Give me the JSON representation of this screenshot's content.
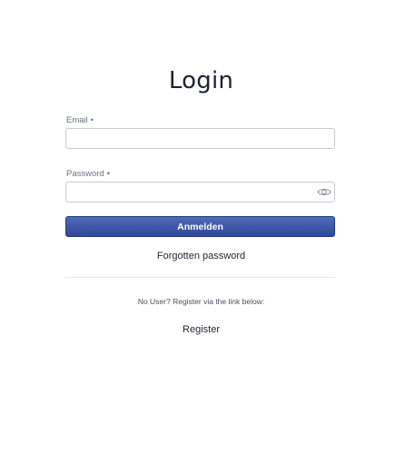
{
  "page": {
    "title": "Login"
  },
  "form": {
    "email": {
      "label": "Email",
      "required_mark": "•",
      "value": "",
      "placeholder": ""
    },
    "password": {
      "label": "Password",
      "required_mark": "•",
      "value": "",
      "placeholder": "",
      "toggle_icon": "eye-icon"
    },
    "submit_label": "Anmelden",
    "forgot_link": "Forgotten password"
  },
  "register": {
    "hint": "No User? Register via the link below:",
    "link_label": "Register"
  },
  "colors": {
    "primary_button": "#3a55a6",
    "primary_button_border": "#233a80",
    "title_text": "#1c2333"
  }
}
